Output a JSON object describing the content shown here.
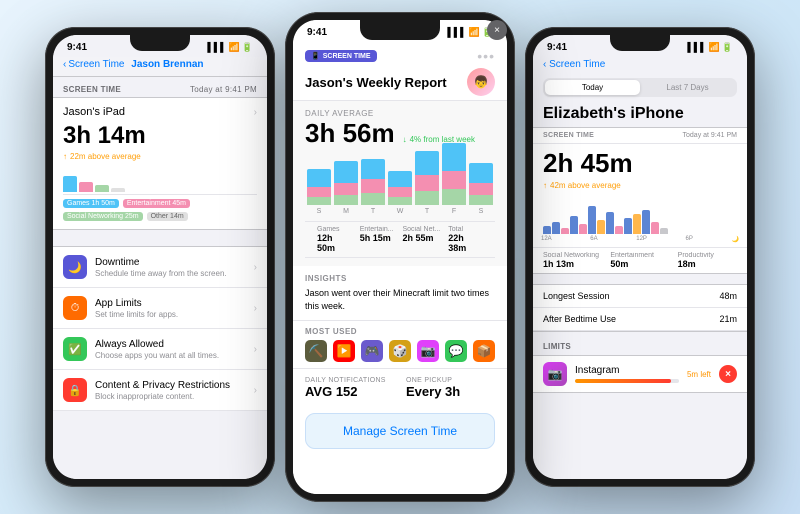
{
  "left_phone": {
    "status_time": "9:41",
    "nav_back": "Screen Time",
    "nav_title": "Jason Brennan",
    "section_header": "SCREEN TIME",
    "section_date": "Today at 9:41 PM",
    "device_name": "Jason's iPad",
    "total_time": "3h 14m",
    "avg_text": "22m above average",
    "categories": [
      {
        "name": "Games",
        "time": "1h 50m",
        "color": "#4fc3f7"
      },
      {
        "name": "Entertainment",
        "time": "45m",
        "color": "#f48fb1"
      },
      {
        "name": "Social Networking",
        "time": "25m",
        "color": "#a5d6a7"
      },
      {
        "name": "Other",
        "time": "14m",
        "color": "#e0e0e0"
      }
    ],
    "list_items": [
      {
        "icon": "🟣",
        "icon_bg": "#5856d6",
        "title": "Downtime",
        "subtitle": "Schedule time away from the screen.",
        "emoji": "🌙"
      },
      {
        "icon": "🟠",
        "icon_bg": "#ff6b00",
        "title": "App Limits",
        "subtitle": "Set time limits for apps.",
        "emoji": "⏱"
      },
      {
        "icon": "🟢",
        "icon_bg": "#34c759",
        "title": "Always Allowed",
        "subtitle": "Choose apps you want at all times.",
        "emoji": "✅"
      },
      {
        "icon": "🔴",
        "icon_bg": "#ff3b30",
        "title": "Content & Privacy Restrictions",
        "subtitle": "Block inappropriate content.",
        "emoji": "🔒"
      }
    ]
  },
  "center_phone": {
    "status_time": "9:41",
    "badge_text": "SCREEN TIME",
    "report_title": "Jason's Weekly Report",
    "daily_avg_label": "Daily Average",
    "daily_avg_time": "3h 56m",
    "weekly_badge": "4% from last week",
    "week_days": [
      "S",
      "M",
      "T",
      "W",
      "T",
      "F",
      "S"
    ],
    "week_bars": [
      {
        "games": 18,
        "entertainment": 10,
        "social": 8
      },
      {
        "games": 22,
        "entertainment": 12,
        "social": 10
      },
      {
        "games": 20,
        "entertainment": 14,
        "social": 12
      },
      {
        "games": 16,
        "entertainment": 10,
        "social": 8
      },
      {
        "games": 24,
        "entertainment": 16,
        "social": 14
      },
      {
        "games": 28,
        "entertainment": 18,
        "social": 16
      },
      {
        "games": 20,
        "entertainment": 12,
        "social": 10
      }
    ],
    "categories": [
      {
        "name": "Games",
        "time": "12h 50m"
      },
      {
        "name": "Entertain...",
        "time": "5h 15m"
      },
      {
        "name": "Social Net...",
        "time": "2h 55m"
      },
      {
        "name": "Total",
        "time": "22h 38m"
      }
    ],
    "insights_title": "Insights",
    "insights_text": "Jason went over their Minecraft limit two times this week.",
    "most_used_title": "Most Used",
    "app_icons": [
      "⛏️",
      "▶️",
      "🎮",
      "🎲",
      "📷",
      "💬",
      "📦"
    ],
    "notifications_label": "Daily Notifications",
    "notifications_avg": "AVG 152",
    "pickup_label": "One Pickup",
    "pickup_value": "Every 3h",
    "manage_btn": "Manage Screen Time",
    "close_icon": "×"
  },
  "right_phone": {
    "status_time": "9:41",
    "nav_back": "Screen Time",
    "device_title": "Elizabeth's iPhone",
    "segment_today": "Today",
    "segment_last7": "Last 7 Days",
    "section_header": "SCREEN TIME",
    "section_date": "Today at 9:41 PM",
    "total_time": "2h 45m",
    "avg_text": "42m above average",
    "time_labels": [
      "12A",
      "6A",
      "12P",
      "6P"
    ],
    "categories": [
      {
        "name": "Social Networking",
        "time": "1h 13m",
        "color": "#5c85d4"
      },
      {
        "name": "Entertainment",
        "time": "50m",
        "color": "#f48fb1"
      },
      {
        "name": "Productivity",
        "time": "18m",
        "color": "#ffb74d"
      }
    ],
    "longest_session_label": "Longest Session",
    "longest_session_value": "48m",
    "after_bedtime_label": "After Bedtime Use",
    "after_bedtime_value": "21m",
    "limits_header": "LIMITS",
    "limit_app": "Instagram",
    "limit_time_left": "5m left",
    "limit_progress": 92
  }
}
